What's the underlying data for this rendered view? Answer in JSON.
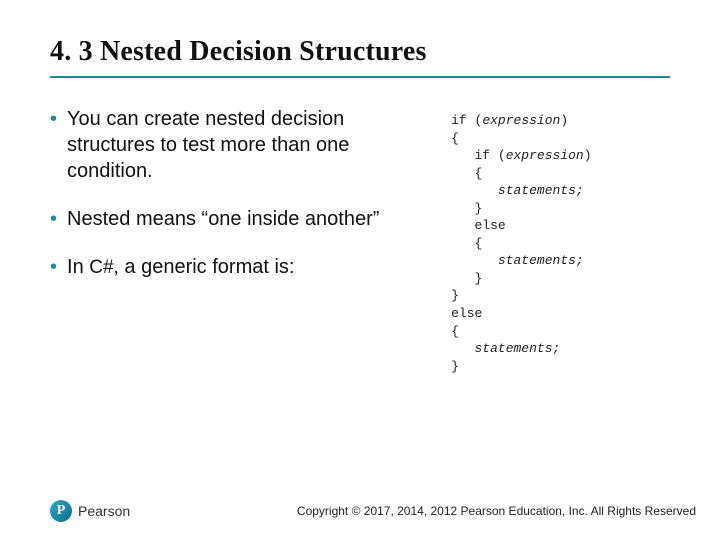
{
  "title": "4. 3 Nested Decision Structures",
  "bullets": [
    "You can create nested decision structures to test more than one condition.",
    "Nested means “one inside another”",
    "In"
  ],
  "bullet3_lang": "C#,",
  "bullet3_tail": " a generic format is:",
  "code": {
    "l1a": "if (",
    "l1b": "expression",
    "l1c": ")",
    "l2": "{",
    "l3a": "   if (",
    "l3b": "expression",
    "l3c": ")",
    "l4": "   {",
    "l5a": "      ",
    "l5b": "statements;",
    "l6": "   }",
    "l7": "   else",
    "l8": "   {",
    "l9a": "      ",
    "l9b": "statements;",
    "l10": "   }",
    "l11": "}",
    "l12": "else",
    "l13": "{",
    "l14a": "   ",
    "l14b": "statements;",
    "l15": "}"
  },
  "logo_letter": "P",
  "logo_name": "Pearson",
  "copyright": "Copyright © 2017, 2014, 2012 Pearson Education, Inc. All Rights Reserved"
}
